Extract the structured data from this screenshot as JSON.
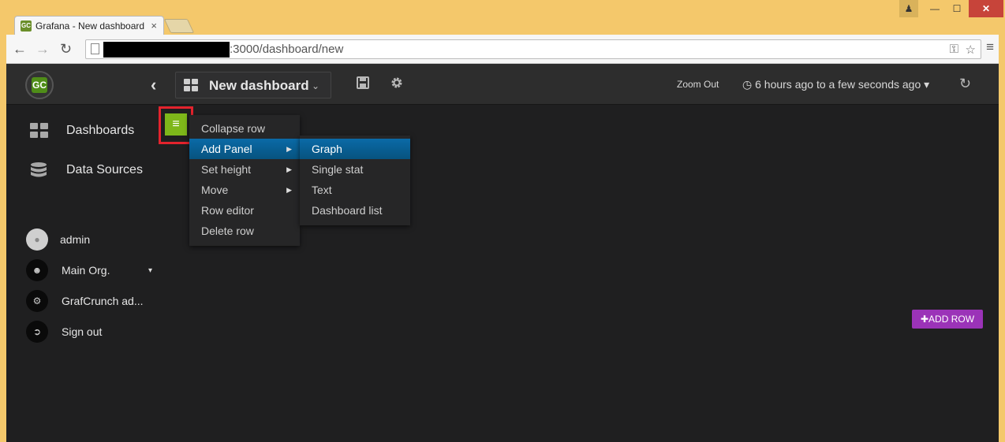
{
  "browser": {
    "tab_title": "Grafana - New dashboard",
    "tab_close": "×",
    "url": ":3000/dashboard/new",
    "back": "←",
    "forward": "→",
    "reload": "↻",
    "menu": "≡",
    "win_min": "—",
    "win_max": "☐",
    "win_close": "✕",
    "key_icon": "⚿",
    "star_icon": "☆"
  },
  "navbar": {
    "logo_text": "GC",
    "back": "‹",
    "dashboard_title": "New dashboard",
    "title_caret": "⌄",
    "save_icon": "save-icon",
    "settings_icon": "gear-icon",
    "zoom_out": "Zoom Out",
    "time_range": "6 hours ago to a few seconds ago",
    "clock_icon": "◷",
    "time_caret": "▾",
    "refresh": "↻"
  },
  "sidemenu": {
    "items": [
      {
        "label": "Dashboards",
        "icon": "grid-icon"
      },
      {
        "label": "Data Sources",
        "icon": "database-icon"
      }
    ],
    "user": {
      "name": "admin",
      "org": "Main Org.",
      "org_caret": "▾",
      "admin_link": "GrafCrunch ad...",
      "sign_out": "Sign out"
    }
  },
  "row_menu": {
    "button_icon": "≡",
    "items": [
      {
        "label": "Collapse row",
        "submenu": false
      },
      {
        "label": "Add Panel",
        "submenu": true,
        "active": true
      },
      {
        "label": "Set height",
        "submenu": true
      },
      {
        "label": "Move",
        "submenu": true
      },
      {
        "label": "Row editor",
        "submenu": false
      },
      {
        "label": "Delete row",
        "submenu": false
      }
    ],
    "arrow": "▶",
    "add_panel_submenu": [
      "Graph",
      "Single stat",
      "Text",
      "Dashboard list"
    ]
  },
  "add_row": "✚ADD ROW",
  "colors": {
    "highlight_box": "#e3232d",
    "row_button": "#7eb71a",
    "active_item": "#0a6aa7",
    "add_row": "#9b33b8"
  }
}
